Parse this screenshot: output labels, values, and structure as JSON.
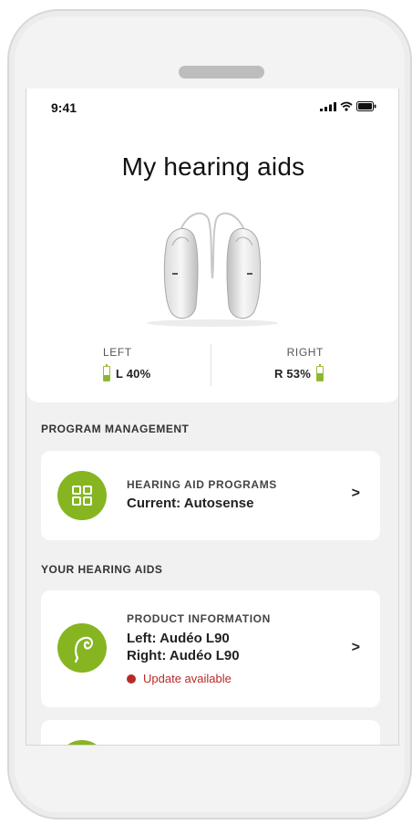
{
  "status_bar": {
    "time": "9:41"
  },
  "header": {
    "title": "My hearing aids"
  },
  "devices": {
    "left": {
      "side_label": "LEFT",
      "battery_text": "L 40%",
      "battery_level": 0.4
    },
    "right": {
      "side_label": "RIGHT",
      "battery_text": "R 53%",
      "battery_level": 0.53
    }
  },
  "program_management": {
    "section_title": "PROGRAM MANAGEMENT",
    "card": {
      "kicker": "HEARING AID PROGRAMS",
      "line1": "Current: Autosense",
      "icon": "grid-icon",
      "chevron": ">"
    }
  },
  "your_hearing_aids": {
    "section_title": "YOUR HEARING AIDS",
    "card": {
      "kicker": "PRODUCT INFORMATION",
      "line1": "Left: Audéo L90",
      "line2": "Right: Audéo L90",
      "update_text": "Update available",
      "icon": "hearing-aid-icon",
      "chevron": ">"
    }
  },
  "colors": {
    "accent_green": "#86b521",
    "alert_red": "#b82a27"
  }
}
